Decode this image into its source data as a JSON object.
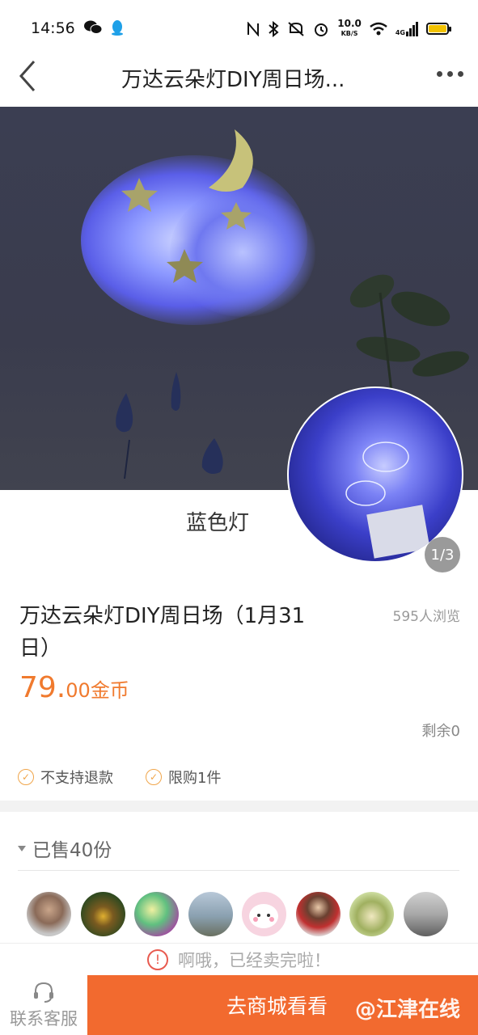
{
  "status_bar": {
    "time": "14:56",
    "left_icons": [
      "wechat-icon",
      "qq-icon"
    ],
    "right_icons": [
      "nfc-icon",
      "bluetooth-icon",
      "mute-icon",
      "alarm-icon"
    ],
    "network_speed": "10.0",
    "network_speed_unit": "KB/S",
    "network_type": "4G"
  },
  "nav": {
    "title": "万达云朵灯DIY周日场...",
    "back_icon": "chevron-left-icon",
    "more_icon": "more-dots-icon"
  },
  "gallery": {
    "caption": "蓝色灯",
    "page_indicator": "1/3"
  },
  "product": {
    "title": "万达云朵灯DIY周日场（1月31日）",
    "views": "595人浏览",
    "price_number": "79.",
    "price_decimal": "00",
    "price_unit": "金币",
    "stock": "剩余0",
    "tags": [
      "不支持退款",
      "限购1件"
    ]
  },
  "sold": {
    "header": "已售40份",
    "avatar_count": 8
  },
  "notice": {
    "text": "啊哦，已经卖完啦！"
  },
  "bottom": {
    "service_label": "联系客服",
    "shop_button": "去商城看看",
    "watermark": "@江津在线"
  },
  "colors": {
    "accent": "#f26a2f",
    "price": "#f07a2e",
    "alert": "#e85a4f"
  }
}
